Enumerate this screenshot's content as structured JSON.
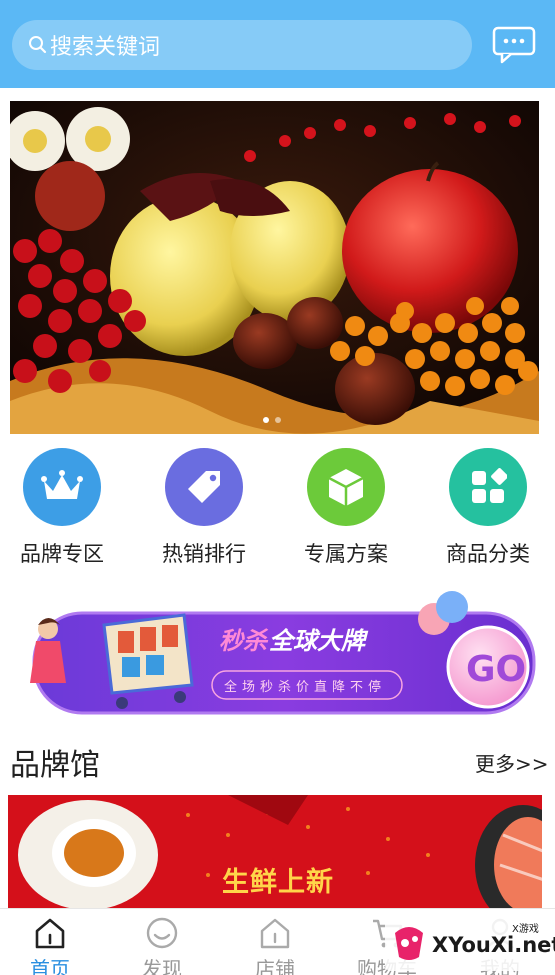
{
  "search": {
    "placeholder": "搜索关键词",
    "icon": "search-icon"
  },
  "header": {
    "message_icon": "message-icon",
    "bg_color": "#5bb8f5"
  },
  "banner": {
    "slide_count": 2,
    "active_slide": 1
  },
  "categories": [
    {
      "label": "品牌专区",
      "icon": "crown-icon",
      "color": "#3d9ee6"
    },
    {
      "label": "热销排行",
      "icon": "tag-icon",
      "color": "#6a6de0"
    },
    {
      "label": "专属方案",
      "icon": "cube-icon",
      "color": "#6cca3a"
    },
    {
      "label": "商品分类",
      "icon": "grid-icon",
      "color": "#25c19f"
    }
  ],
  "promo": {
    "title": "秒杀全球大牌",
    "subtitle": "全场秒杀价直降不停",
    "go": "GO"
  },
  "brand_section": {
    "title": "品牌馆",
    "more": "更多>>",
    "banner_text": "生鲜上新"
  },
  "nav": [
    {
      "label": "首页",
      "icon": "home-icon",
      "active": true
    },
    {
      "label": "发现",
      "icon": "discover-icon",
      "active": false
    },
    {
      "label": "店铺",
      "icon": "shop-icon",
      "active": false
    },
    {
      "label": "购物车",
      "icon": "cart-icon",
      "active": false
    },
    {
      "label": "我的",
      "icon": "profile-icon",
      "active": false
    }
  ],
  "watermark": {
    "text": "XYouXi.net",
    "small": "X游戏"
  }
}
